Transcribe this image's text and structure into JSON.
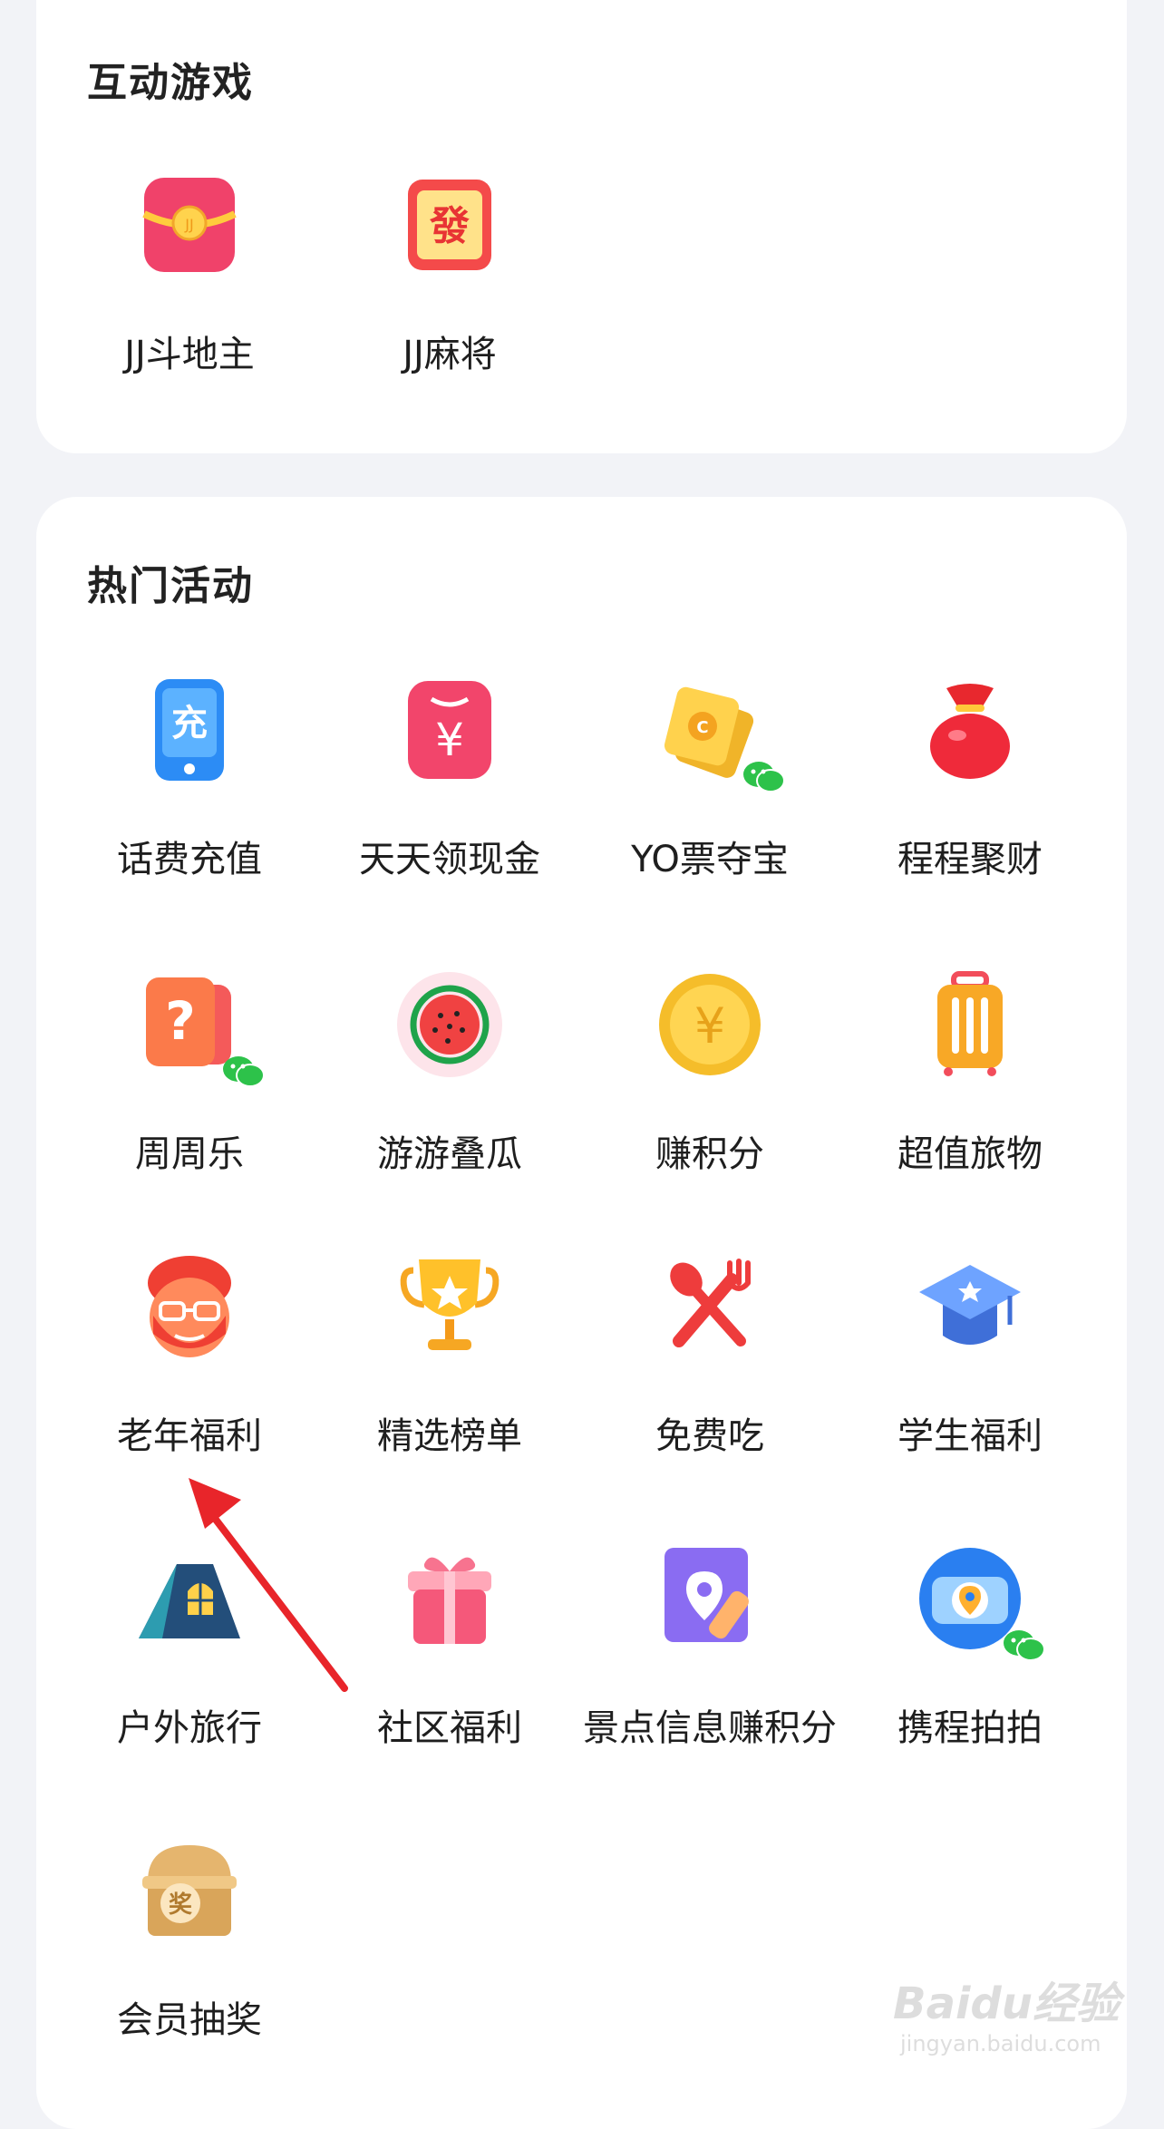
{
  "games": {
    "title": "互动游戏",
    "items": [
      {
        "label": "JJ斗地主",
        "icon": "red-envelope-coin-icon"
      },
      {
        "label": "JJ麻将",
        "icon": "mahjong-fa-tile-icon"
      }
    ]
  },
  "hot": {
    "title": "热门活动",
    "items": [
      {
        "label": "话费充值",
        "icon": "phone-recharge-icon"
      },
      {
        "label": "天天领现金",
        "icon": "yuan-envelope-icon"
      },
      {
        "label": "YO票夺宝",
        "icon": "yo-ticket-icon"
      },
      {
        "label": "程程聚财",
        "icon": "money-bag-icon"
      },
      {
        "label": "周周乐",
        "icon": "question-card-icon"
      },
      {
        "label": "游游叠瓜",
        "icon": "watermelon-icon"
      },
      {
        "label": "赚积分",
        "icon": "gold-coin-icon"
      },
      {
        "label": "超值旅物",
        "icon": "suitcase-icon"
      },
      {
        "label": "老年福利",
        "icon": "grandpa-icon"
      },
      {
        "label": "精选榜单",
        "icon": "trophy-icon"
      },
      {
        "label": "免费吃",
        "icon": "fork-spoon-icon"
      },
      {
        "label": "学生福利",
        "icon": "graduation-cap-icon"
      },
      {
        "label": "户外旅行",
        "icon": "tent-icon"
      },
      {
        "label": "社区福利",
        "icon": "gift-box-icon"
      },
      {
        "label": "景点信息赚积分",
        "icon": "map-pin-pencil-icon"
      },
      {
        "label": "携程拍拍",
        "icon": "camera-icon"
      },
      {
        "label": "会员抽奖",
        "icon": "prize-chest-icon"
      }
    ]
  },
  "watermark": {
    "main": "Baidu经验",
    "sub": "jingyan.baidu.com"
  },
  "colors": {
    "background": "#f2f3f7",
    "card": "#ffffff",
    "arrow": "#e8252a"
  }
}
